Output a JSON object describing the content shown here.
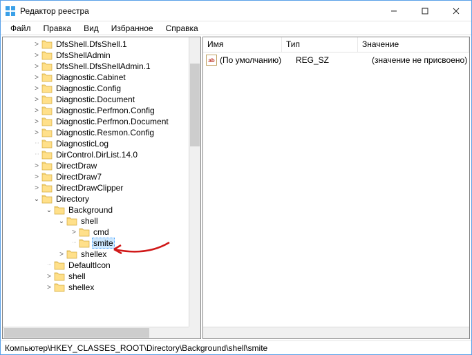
{
  "title": "Редактор реестра",
  "menu": {
    "file": "Файл",
    "edit": "Правка",
    "view": "Вид",
    "favorites": "Избранное",
    "help": "Справка"
  },
  "tree": {
    "items": [
      {
        "label": "DfsShell.DfsShell.1",
        "indent": "indent-1",
        "exp": ">"
      },
      {
        "label": "DfsShellAdmin",
        "indent": "indent-1",
        "exp": ">"
      },
      {
        "label": "DfsShell.DfsShellAdmin.1",
        "indent": "indent-1",
        "exp": ">"
      },
      {
        "label": "Diagnostic.Cabinet",
        "indent": "indent-1",
        "exp": ">"
      },
      {
        "label": "Diagnostic.Config",
        "indent": "indent-1",
        "exp": ">"
      },
      {
        "label": "Diagnostic.Document",
        "indent": "indent-1",
        "exp": ">"
      },
      {
        "label": "Diagnostic.Perfmon.Config",
        "indent": "indent-1",
        "exp": ">"
      },
      {
        "label": "Diagnostic.Perfmon.Document",
        "indent": "indent-1",
        "exp": ">"
      },
      {
        "label": "Diagnostic.Resmon.Config",
        "indent": "indent-1",
        "exp": ">"
      },
      {
        "label": "DiagnosticLog",
        "indent": "indent-1",
        "exp": ""
      },
      {
        "label": "DirControl.DirList.14.0",
        "indent": "indent-1",
        "exp": ""
      },
      {
        "label": "DirectDraw",
        "indent": "indent-1",
        "exp": ">"
      },
      {
        "label": "DirectDraw7",
        "indent": "indent-1",
        "exp": ">"
      },
      {
        "label": "DirectDrawClipper",
        "indent": "indent-1",
        "exp": ">"
      },
      {
        "label": "Directory",
        "indent": "indent-1",
        "exp": "v"
      },
      {
        "label": "Background",
        "indent": "indent-2",
        "exp": "v"
      },
      {
        "label": "shell",
        "indent": "indent-3",
        "exp": "v"
      },
      {
        "label": "cmd",
        "indent": "indent-4",
        "exp": ">"
      },
      {
        "label": "smite",
        "indent": "indent-4",
        "exp": "",
        "selected": true
      },
      {
        "label": "shellex",
        "indent": "indent-3",
        "exp": ">"
      },
      {
        "label": "DefaultIcon",
        "indent": "indent-2",
        "exp": ""
      },
      {
        "label": "shell",
        "indent": "indent-2",
        "exp": ">"
      },
      {
        "label": "shellex",
        "indent": "indent-2",
        "exp": ">"
      }
    ]
  },
  "columns": {
    "name": "Имя",
    "type": "Тип",
    "data": "Значение"
  },
  "value": {
    "icon": "ab",
    "name": "(По умолчанию)",
    "type": "REG_SZ",
    "data": "(значение не присвоено)"
  },
  "status": "Компьютер\\HKEY_CLASSES_ROOT\\Directory\\Background\\shell\\smite"
}
